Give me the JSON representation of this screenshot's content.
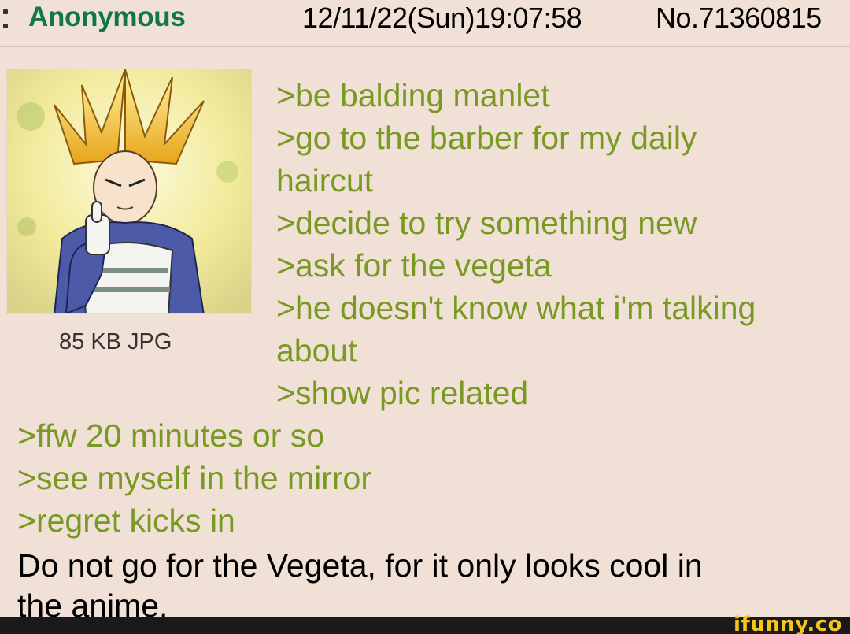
{
  "header": {
    "name": "Anonymous",
    "datetime": "12/11/22(Sun)19:07:58",
    "post_number": "No.71360815"
  },
  "file": {
    "info": "85 KB JPG",
    "thumbnail": "vegeta-thumbs-up-image"
  },
  "body": {
    "lines_right": [
      ">be balding manlet",
      ">go to the barber for my daily",
      "haircut",
      ">decide to try something new",
      ">ask for the vegeta",
      ">he doesn't know what i'm talking",
      "about",
      ">show pic related"
    ],
    "lines_wide": [
      ">ffw 20 minutes or so",
      ">see myself in the mirror",
      ">regret kicks in"
    ],
    "closing_line_1": "Do not go for the Vegeta, for it only looks cool in",
    "closing_line_2": "the anime."
  },
  "watermark": {
    "text": "ifunny.co"
  },
  "colors": {
    "background": "#f0e0d6",
    "name": "#117743",
    "greentext": "#789922"
  }
}
